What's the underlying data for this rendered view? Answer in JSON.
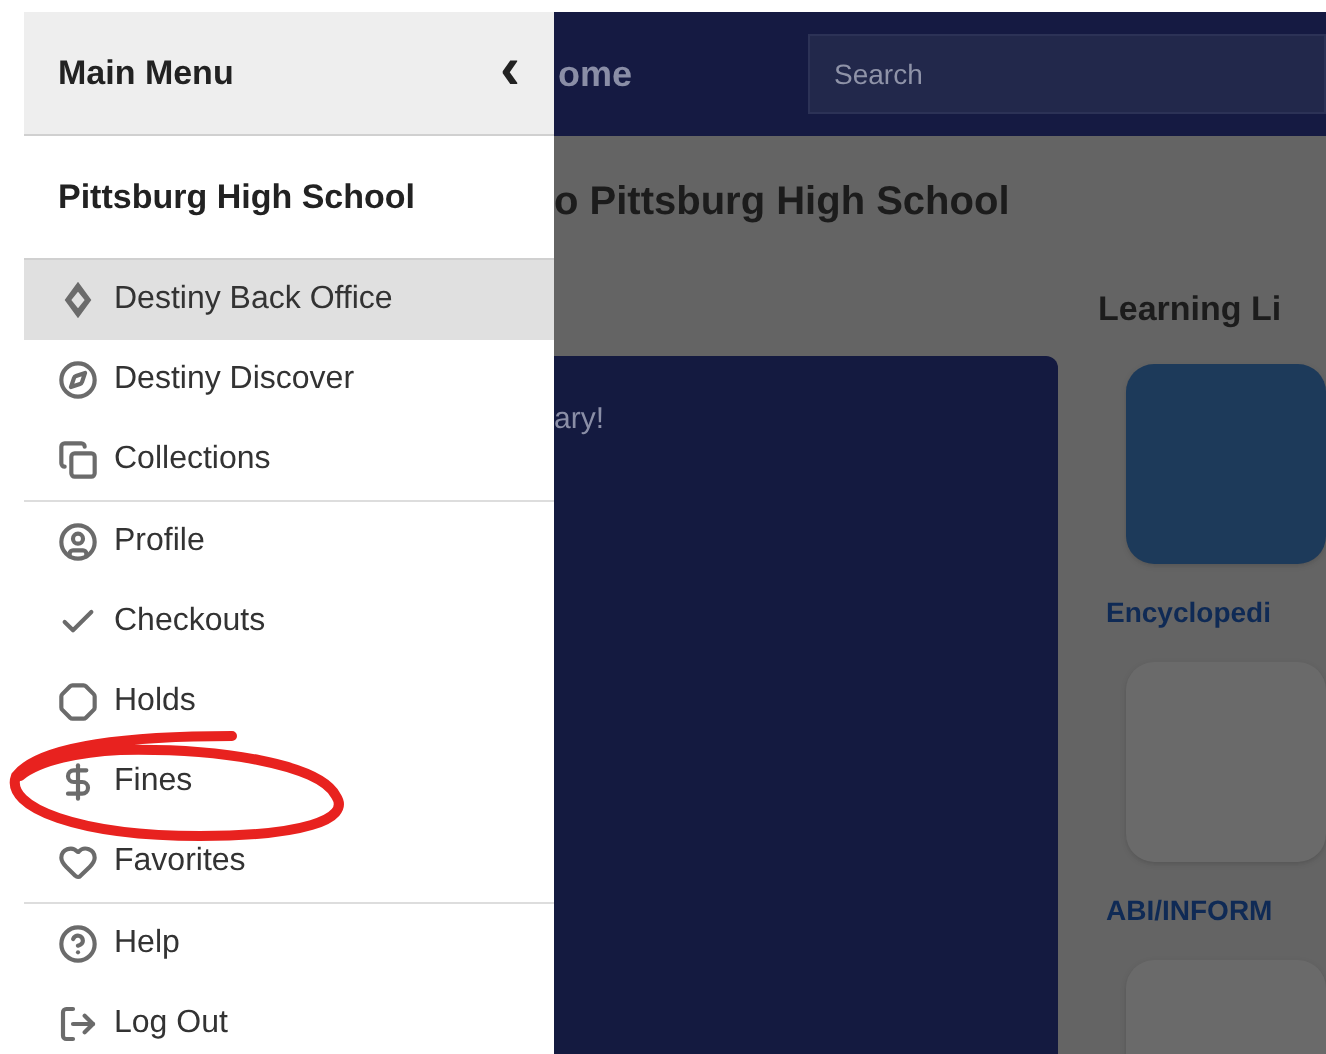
{
  "drawer": {
    "title": "Main Menu",
    "close": "‹",
    "school": "Pittsburg High School",
    "sections": [
      {
        "items": [
          {
            "label": "Destiny Back Office",
            "selected": true
          },
          {
            "label": "Destiny Discover",
            "selected": false
          },
          {
            "label": "Collections",
            "selected": false
          }
        ]
      },
      {
        "items": [
          {
            "label": "Profile",
            "selected": false
          },
          {
            "label": "Checkouts",
            "selected": false
          },
          {
            "label": "Holds",
            "selected": false
          },
          {
            "label": "Fines",
            "selected": false
          },
          {
            "label": "Favorites",
            "selected": false
          }
        ]
      },
      {
        "items": [
          {
            "label": "Help",
            "selected": false
          },
          {
            "label": "Log Out",
            "selected": false
          }
        ]
      }
    ]
  },
  "page": {
    "header_title": "ome",
    "search": {
      "placeholder": "Search"
    },
    "heading": "o Pittsburg High School",
    "welcome_card": {
      "text": "ary!"
    },
    "learning_links": {
      "title": "Learning Li",
      "tiles": [
        {
          "label": "Encyclopedi"
        },
        {
          "label": "ABI/INFORM"
        }
      ]
    }
  }
}
